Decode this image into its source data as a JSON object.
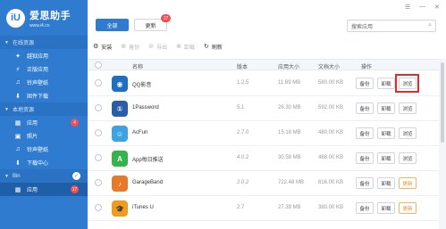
{
  "brand": {
    "logo": "iU",
    "name": "爱思助手",
    "url": "www.i4.cn"
  },
  "sidebar": {
    "online_label": "在线资源",
    "online_items": [
      {
        "label": "越狱应用",
        "icon": "gear-icon"
      },
      {
        "label": "正版应用",
        "icon": "apps-icon"
      },
      {
        "label": "铃声壁纸",
        "icon": "music-icon"
      },
      {
        "label": "固件下载",
        "icon": "download-icon"
      }
    ],
    "local_label": "本地资源",
    "local_items": [
      {
        "label": "应用",
        "icon": "grid-icon",
        "badge": "4"
      },
      {
        "label": "照片",
        "icon": "photo-icon"
      },
      {
        "label": "铃声壁纸",
        "icon": "music-icon"
      },
      {
        "label": "下载中心",
        "icon": "download-icon"
      }
    ],
    "device_label": "Bin",
    "device_items": [
      {
        "label": "应用",
        "icon": "grid-icon",
        "badge": "17"
      }
    ]
  },
  "tabs": {
    "all": "全部",
    "updates": "更新",
    "updates_badge": "17"
  },
  "search": {
    "placeholder": "搜索应用"
  },
  "toolbar": {
    "install": "安装",
    "backup": "备份",
    "export": "导出",
    "uninstall": "卸载",
    "refresh": "刷新"
  },
  "table": {
    "headers": {
      "name": "名称",
      "version": "版本",
      "app_size": "应用大小",
      "doc_size": "文档大小",
      "action": "操作"
    },
    "rows": [
      {
        "name": "QQ影音",
        "version": "1.2.5",
        "app_size": "11.69 MB",
        "doc_size": "580.00 KB",
        "b1": "备份",
        "b2": "卸载",
        "b3": "浏览",
        "icon_color": "#1c6fc4"
      },
      {
        "name": "1Password",
        "version": "5.1",
        "app_size": "26.30 MB",
        "doc_size": "592.00 KB",
        "b1": "备份",
        "b2": "卸载",
        "b3": "浏览",
        "icon_color": "#2a5ea8"
      },
      {
        "name": "AcFun",
        "version": "2.7.0",
        "app_size": "15.18 MB",
        "doc_size": "480.00 KB",
        "b1": "备份",
        "b2": "卸载",
        "b3": "浏览",
        "icon_color": "#3aa3e0"
      },
      {
        "name": "App每日推送",
        "version": "4.0.2",
        "app_size": "30.58 MB",
        "doc_size": "488.00 KB",
        "b1": "备份",
        "b2": "卸载",
        "b3": "浏览",
        "icon_color": "#36b34a"
      },
      {
        "name": "GarageBand",
        "version": "2.0.2",
        "app_size": "722.48 MB",
        "doc_size": "816.00 KB",
        "b1": "备份",
        "b2": "卸载",
        "b3": "更新",
        "icon_color": "#e8792b"
      },
      {
        "name": "iTunes U",
        "version": "2.7",
        "app_size": "27.39 MB",
        "doc_size": "380.00 KB",
        "b1": "备份",
        "b2": "卸载",
        "b3": "更新",
        "icon_color": "#f39a1b"
      }
    ]
  },
  "colors": {
    "accent": "#2e7bd0",
    "badge": "#f05050",
    "highlight": "#d9302c",
    "update": "#f08a24"
  }
}
